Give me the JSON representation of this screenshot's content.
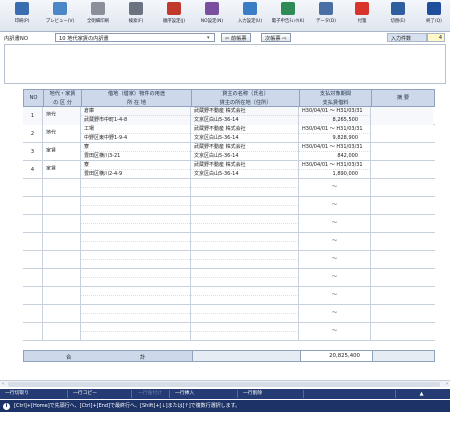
{
  "toolbar": [
    {
      "label": "印刷(P)",
      "icon": "printer-icon",
      "color": "#3a6db0"
    },
    {
      "label": "プレビュー(V)",
      "icon": "preview-icon",
      "color": "#4a86c8"
    },
    {
      "label": "全明細印刷",
      "icon": "print-all-icon",
      "color": "#8a8f99"
    },
    {
      "label": "検索(F)",
      "icon": "search-icon",
      "color": "#6b7280"
    },
    {
      "label": "順序設定(J)",
      "icon": "order-icon",
      "color": "#c0392b"
    },
    {
      "label": "NO設定(N)",
      "icon": "number-icon",
      "color": "#7a4fa0"
    },
    {
      "label": "入力設定(U)",
      "icon": "input-settings-icon",
      "color": "#3b7dc4"
    },
    {
      "label": "電子申告ﾁｪｯｸ(K)",
      "icon": "e-check-icon",
      "color": "#2e8b57"
    },
    {
      "label": "データ(D)",
      "icon": "data-icon",
      "color": "#4a6fa5"
    },
    {
      "label": "付箋",
      "icon": "sticky-note-icon",
      "color": "#d9342b"
    },
    {
      "label": "切替(E)",
      "icon": "switch-icon",
      "color": "#2f5e9e"
    },
    {
      "label": "終了(Q)",
      "icon": "exit-icon",
      "color": "#1f4e9c"
    }
  ],
  "selector": {
    "label": "内訳書NO",
    "value": "10 地代家賃の内訳書",
    "prev": "前帳票",
    "next": "次帳票",
    "count_label": "入力件数",
    "count_value": "4"
  },
  "table": {
    "headers": {
      "no": "NO",
      "kubun": [
        "地代・家賃",
        "の 区 分"
      ],
      "property": [
        "借地（借家）物件の用途",
        "所 在 地"
      ],
      "landlord": [
        "貸主の名称（氏名）",
        "貸主の所在地（住所）"
      ],
      "period": [
        "支払対象期間",
        "支払賃借料"
      ],
      "note": "摘 要"
    },
    "rows": [
      {
        "no": "1",
        "kubun": "地代",
        "use": "倉庫",
        "addr": "武蔵野市中町1-4-8",
        "name": "武蔵野不動産 株式会社",
        "lladdr": "文京区白山5-36-14",
        "period": "H30/04/01 ～ H31/03/31",
        "amount": "8,265,500",
        "note": ""
      },
      {
        "no": "2",
        "kubun": "地代",
        "use": "工場",
        "addr": "中野区東中野1-9-4",
        "name": "武蔵野不動産 株式会社",
        "lladdr": "文京区白山5-36-14",
        "period": "H30/04/01 ～ H31/03/31",
        "amount": "9,828,900",
        "note": ""
      },
      {
        "no": "3",
        "kubun": "家賃",
        "use": "寮",
        "addr": "豊田区横川3-21",
        "name": "武蔵野不動産 株式会社",
        "lladdr": "文京区白山5-36-14",
        "period": "H30/04/01 ～ H31/03/31",
        "amount": "842,000",
        "note": ""
      },
      {
        "no": "4",
        "kubun": "家賃",
        "use": "寮",
        "addr": "豊田区横川2-4-9",
        "name": "武蔵野不動産 株式会社",
        "lladdr": "文京区白山5-36-14",
        "period": "H30/04/01 ～ H31/03/31",
        "amount": "1,890,000",
        "note": ""
      }
    ],
    "empty_row_count": 9,
    "tilde": "～",
    "total_label_left": "合",
    "total_label_right": "計",
    "total_amount": "20,825,400"
  },
  "function_bar": [
    "一行切取り",
    "一行コピー",
    "一行貼付け",
    "一行挿入",
    "一行削除"
  ],
  "status": "[Ctrl]+[Home]で先頭行へ、[Ctrl]+[End]で最終行へ、[Shift]+[↓]または[↑]で複数行選択します。"
}
